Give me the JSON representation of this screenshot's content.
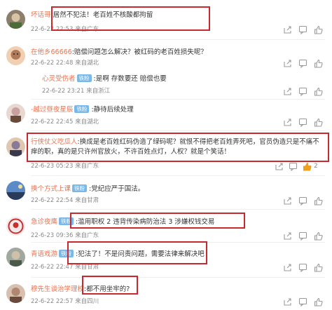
{
  "comments": [
    {
      "user": "坏话哥",
      "text": ":居然不犯法！老百姓不核酸都拘留",
      "meta": "22-6-22 22:53 来自广东",
      "avatar_colors": [
        "#8b7e6a",
        "#4d6b3a"
      ]
    },
    {
      "user": "在他乡66666",
      "text": ":赔偿问题怎么解决？被红码的老百姓损失呢？",
      "meta": "22-6-22 22:48 来自湖北",
      "avatar_colors": [
        "#b07a5a",
        "#f0d0b0"
      ],
      "reply": {
        "user": "心灵受伤者",
        "badge": "铁粉",
        "text": ":是啊 存数要还 赔偿也要",
        "meta": "22-6-22 23:21 来自浙江"
      }
    },
    {
      "user": "-越过昼夜星辰",
      "badge": "铁粉",
      "text": ":静待后续处理",
      "meta": "22-6-22 22:45 来自湖北",
      "avatar_colors": [
        "#c9a0a0",
        "#6a4a3a"
      ]
    },
    {
      "user": "行侠仗义吃瓜人",
      "text": ":换成是老百姓红码伪造了绿码呢？就恨不得把老百姓弄死吧，官员伪造只是不痛不痒的职，真的是只许州官放火，不许百姓点灯，人权？就是个笑话！",
      "meta": "22-6-23 05:23 来自广东",
      "like_count": "2",
      "avatar_colors": [
        "#8a7a9a",
        "#e0c8b0"
      ]
    },
    {
      "user": "换个方式上课",
      "badge": "铁粉",
      "text": ":党纪应严于国法。",
      "meta": "22-6-22 22:54 来自甘肃",
      "avatar_colors": [
        "#5a8ac8",
        "#2a3a5a"
      ]
    },
    {
      "user": "急诊夜鹰",
      "badge": "铁粉",
      "text": ":滥用职权 2 违背传染病防治法 3 涉嫌权钱交易",
      "meta": "22-6-23 09:36 来自广东",
      "avatar_colors": [
        "#f5e8e8",
        "#c83030"
      ]
    },
    {
      "user": "青语戏游",
      "badge": "铁粉",
      "text": ":犯法了！不是问责问题，需要法律来解决吧",
      "meta": "22-6-22 22:47 来自甘肃",
      "avatar_colors": [
        "#a0a8a0",
        "#4a5a4a"
      ]
    },
    {
      "user": "穆先生谈治学理校",
      "text": ":都不用坐牢的?",
      "meta": "22-6-22 22:57 来自四川",
      "avatar_colors": [
        "#d8c0b0",
        "#6a4a3a"
      ]
    }
  ],
  "colors": {
    "username": "#eb7350",
    "highlight_box": "#c8282e",
    "badge": "#7ab8e8",
    "liked": "#f0a020"
  },
  "icons": [
    "share-icon",
    "comment-icon",
    "like-icon"
  ]
}
